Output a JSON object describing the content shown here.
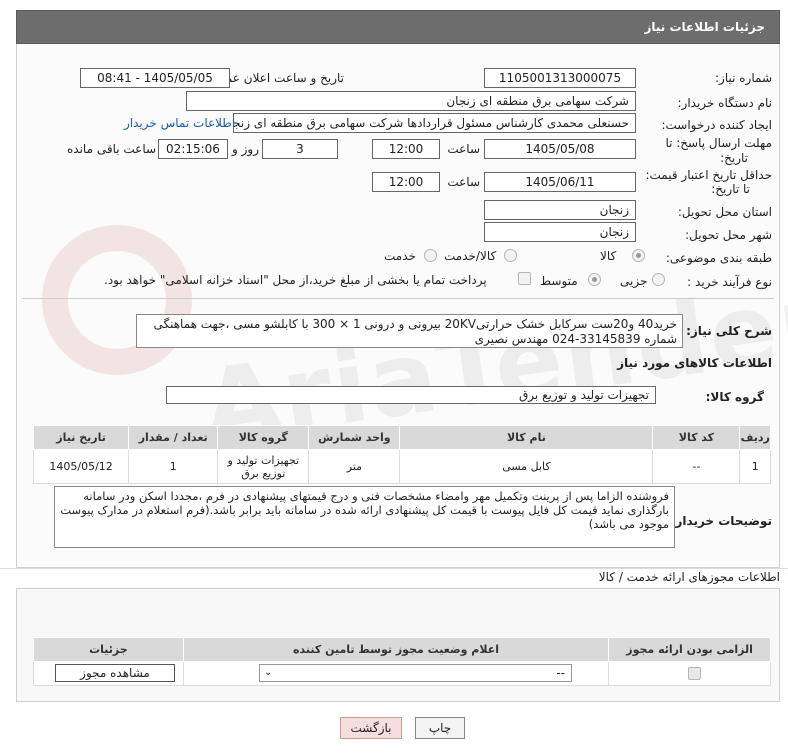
{
  "header": {
    "title": "جزئیات اطلاعات نیاز"
  },
  "fields": {
    "need_number_label": "شماره نیاز:",
    "need_number": "1105001313000075",
    "announce_label": "تاریخ و ساعت اعلان عمومی:",
    "announce_value": "1405/05/05 - 08:41",
    "buyer_label": "نام دستگاه خریدار:",
    "buyer_value": "شرکت سهامی برق منطقه ای زنجان",
    "creator_label": "ایجاد کننده درخواست:",
    "creator_value": "حسنعلی محمدی کارشناس مسئول قراردادها شرکت سهامی برق منطقه ای زنجان",
    "contact_link": "اطلاعات تماس خریدار",
    "deadline_label_1": "مهلت ارسال پاسخ: تا",
    "deadline_label_2": "تاریخ:",
    "deadline_date": "1405/05/08",
    "time_label": "ساعت",
    "deadline_time": "12:00",
    "days_value": "3",
    "days_label": "روز و",
    "remaining_time": "02:15:06",
    "remaining_label": "ساعت باقی مانده",
    "validity_label_1": "حداقل تاریخ اعتبار قیمت:",
    "validity_label_2": "تا تاریخ:",
    "validity_date": "1405/06/11",
    "validity_time": "12:00",
    "province_label": "استان محل تحویل:",
    "province_value": "زنجان",
    "city_label": "شهر محل تحویل:",
    "city_value": "زنجان",
    "category_label": "طبقه بندی موضوعی:",
    "category_options": [
      "کالا",
      "کالا/خدمت",
      "خدمت"
    ],
    "process_label": "نوع فرآیند خرید :",
    "process_options": [
      "جزیی",
      "متوسط"
    ],
    "payment_note": "پرداخت تمام یا بخشی از مبلغ خرید،از محل \"اسناد خزانه اسلامی\" خواهد بود.",
    "summary_label": "شرح کلی نیاز:",
    "summary_value": "خرید40  و20ست  سرکابل خشک حرارتی20KV بیرونی و درونی 1 × 300 با کابلشو مسی ،جهت هماهنگی شماره 33145839-024 مهندس نصیری"
  },
  "goods": {
    "section_title": "اطلاعات کالاهای مورد نیاز",
    "group_label": "گروه کالا:",
    "group_value": "تجهیزات تولید و توزیع برق",
    "columns": [
      "ردیف",
      "کد کالا",
      "نام کالا",
      "واحد شمارش",
      "گروه کالا",
      "تعداد / مقدار",
      "تاریخ نیاز"
    ],
    "rows": [
      [
        "1",
        "--",
        "کابل مسی",
        "متر",
        "تجهیزات تولید و توزیع برق",
        "1",
        "1405/05/12"
      ]
    ]
  },
  "buyer_notes": {
    "label": "توضیحات خریدار:",
    "text": "فروشنده الزاما پس از پرینت وتکمیل مهر وامضاء مشخصات فنی و درج قیمتهای پیشنهادی در فرم ،مجددا اسکن ودر سامانه بارگذاری نماید قیمت کل فایل پیوست با قیمت کل پیشنهادی ارائه شده در سامانه باید برابر باشد.(فرم  استعلام در مدارک پیوست موجود می باشد)"
  },
  "permits": {
    "section_title": "اطلاعات مجوزهای ارائه خدمت / کالا",
    "columns": [
      "الزامی بودن ارائه مجوز",
      "اعلام وضعیت مجوز توسط تامین کننده",
      "جزئیات"
    ],
    "select_value": "--",
    "view_button": "مشاهده مجوز"
  },
  "actions": {
    "print": "چاپ",
    "back": "بازگشت"
  },
  "watermark": "AriaTender.net"
}
